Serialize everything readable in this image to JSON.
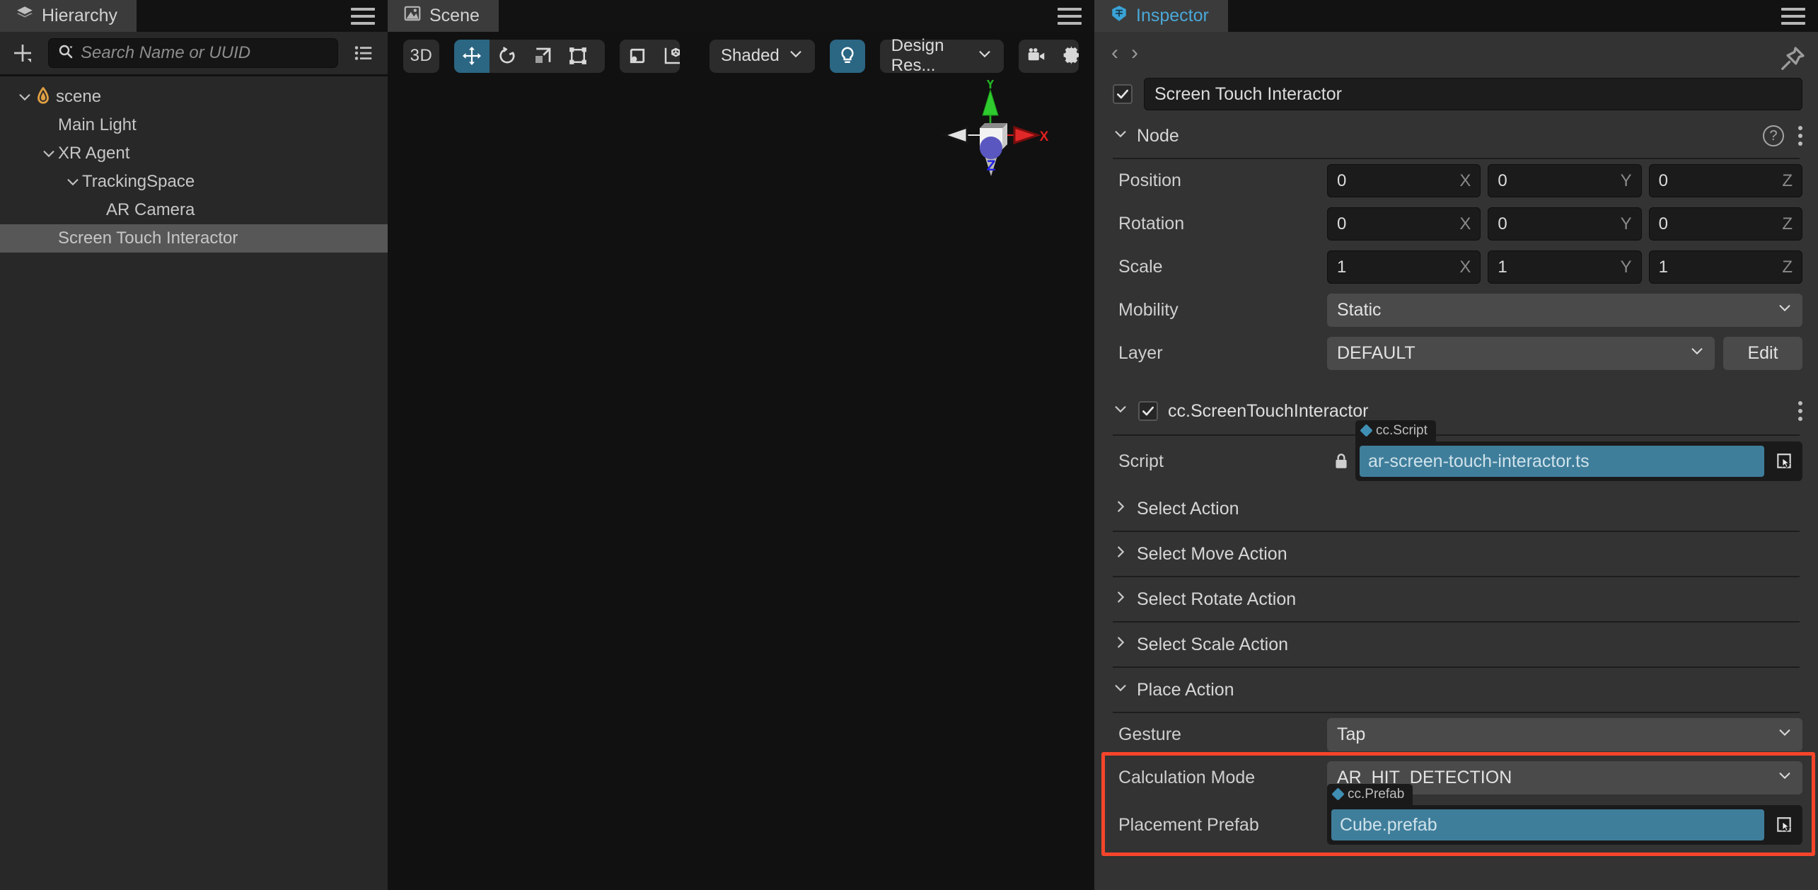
{
  "hierarchy": {
    "tab_label": "Hierarchy",
    "tab_icon": "layers-icon",
    "menu_icon": "hamburger-menu-icon",
    "add_icon": "add-node-icon",
    "filter_icon": "filter-list-icon",
    "search": {
      "placeholder": "Search Name or UUID",
      "value": "",
      "icon": "search-icon"
    },
    "items": [
      {
        "label": "scene",
        "depth": 0,
        "expanded": true,
        "has_children": true,
        "icon": "scene-flame-icon",
        "selected": false
      },
      {
        "label": "Main Light",
        "depth": 1,
        "expanded": false,
        "has_children": false,
        "icon": "",
        "selected": false
      },
      {
        "label": "XR Agent",
        "depth": 1,
        "expanded": true,
        "has_children": true,
        "icon": "",
        "selected": false
      },
      {
        "label": "TrackingSpace",
        "depth": 2,
        "expanded": true,
        "has_children": true,
        "icon": "",
        "selected": false
      },
      {
        "label": "AR Camera",
        "depth": 3,
        "expanded": false,
        "has_children": false,
        "icon": "",
        "selected": false
      },
      {
        "label": "Screen Touch Interactor",
        "depth": 1,
        "expanded": false,
        "has_children": false,
        "icon": "",
        "selected": true
      }
    ]
  },
  "scene": {
    "tab_label": "Scene",
    "tab_icon": "image-icon",
    "menu_icon": "hamburger-menu-icon",
    "toolbar": {
      "mode_3d": "3D",
      "transform_tools": [
        {
          "name": "move-tool",
          "icon": "move-arrows-icon",
          "active": true
        },
        {
          "name": "rotate-tool",
          "icon": "rotate-icon",
          "active": false
        },
        {
          "name": "scale-tool",
          "icon": "scale-icon",
          "active": false
        },
        {
          "name": "rect-tool",
          "icon": "rect-transform-icon",
          "active": false
        },
        {
          "name": "magnet-tool",
          "icon": "magnet-icon",
          "active": false
        }
      ],
      "pivot_tools": [
        {
          "name": "pivot-toggle",
          "icon": "pivot-icon",
          "active": false
        },
        {
          "name": "coordinate-toggle",
          "icon": "local-global-icon",
          "active": false
        }
      ],
      "shading": {
        "label": "Shaded",
        "icon": "chevron-down-icon"
      },
      "lighting": {
        "name": "lighting-toggle",
        "icon": "lightbulb-icon",
        "active": true
      },
      "resolution": {
        "label": "Design Res...",
        "icon": "chevron-down-icon"
      },
      "camera_icon": "camera-icon",
      "settings_icon": "gear-icon"
    },
    "gizmo": {
      "x_label": "X",
      "y_label": "Y",
      "z_label": "Z",
      "x_color": "#e02020",
      "y_color": "#23b523",
      "z_color": "#2020e0"
    }
  },
  "inspector": {
    "tab_label": "Inspector",
    "tab_icon": "inspector-icon",
    "tab_color": "#4aa8d8",
    "menu_icon": "hamburger-menu-icon",
    "nav": {
      "back": "‹",
      "forward": "›",
      "pin_icon": "pin-icon"
    },
    "node": {
      "enabled": true,
      "name": "Screen Touch Interactor",
      "section_title": "Node",
      "expanded": true,
      "help_icon": "question-mark-icon",
      "menu_icon": "kebab-menu-icon",
      "transform": [
        {
          "label": "Position",
          "x": "0",
          "y": "0",
          "z": "0"
        },
        {
          "label": "Rotation",
          "x": "0",
          "y": "0",
          "z": "0"
        },
        {
          "label": "Scale",
          "x": "1",
          "y": "1",
          "z": "1"
        }
      ],
      "axis_labels": {
        "x": "X",
        "y": "Y",
        "z": "Z"
      },
      "mobility": {
        "label": "Mobility",
        "value": "Static"
      },
      "layer": {
        "label": "Layer",
        "value": "DEFAULT",
        "edit_label": "Edit"
      }
    },
    "component": {
      "title": "cc.ScreenTouchInteractor",
      "enabled": true,
      "expanded": true,
      "menu_icon": "kebab-menu-icon",
      "script": {
        "label": "Script",
        "lock_icon": "lock-icon",
        "type_tooltip": "cc.Script",
        "value": "ar-screen-touch-interactor.ts",
        "picker_icon": "asset-picker-icon"
      },
      "sections": [
        {
          "label": "Select Action",
          "expanded": false
        },
        {
          "label": "Select Move Action",
          "expanded": false
        },
        {
          "label": "Select Rotate Action",
          "expanded": false
        },
        {
          "label": "Select Scale Action",
          "expanded": false
        }
      ],
      "place_action": {
        "label": "Place Action",
        "expanded": true,
        "gesture": {
          "label": "Gesture",
          "value": "Tap"
        },
        "calculation_mode": {
          "label": "Calculation Mode",
          "value": "AR_HIT_DETECTION"
        },
        "placement_prefab": {
          "label": "Placement Prefab",
          "type_tooltip": "cc.Prefab",
          "value": "Cube.prefab",
          "picker_icon": "asset-picker-icon"
        }
      }
    },
    "annotation": {
      "highlight_color": "#f5452b"
    }
  }
}
